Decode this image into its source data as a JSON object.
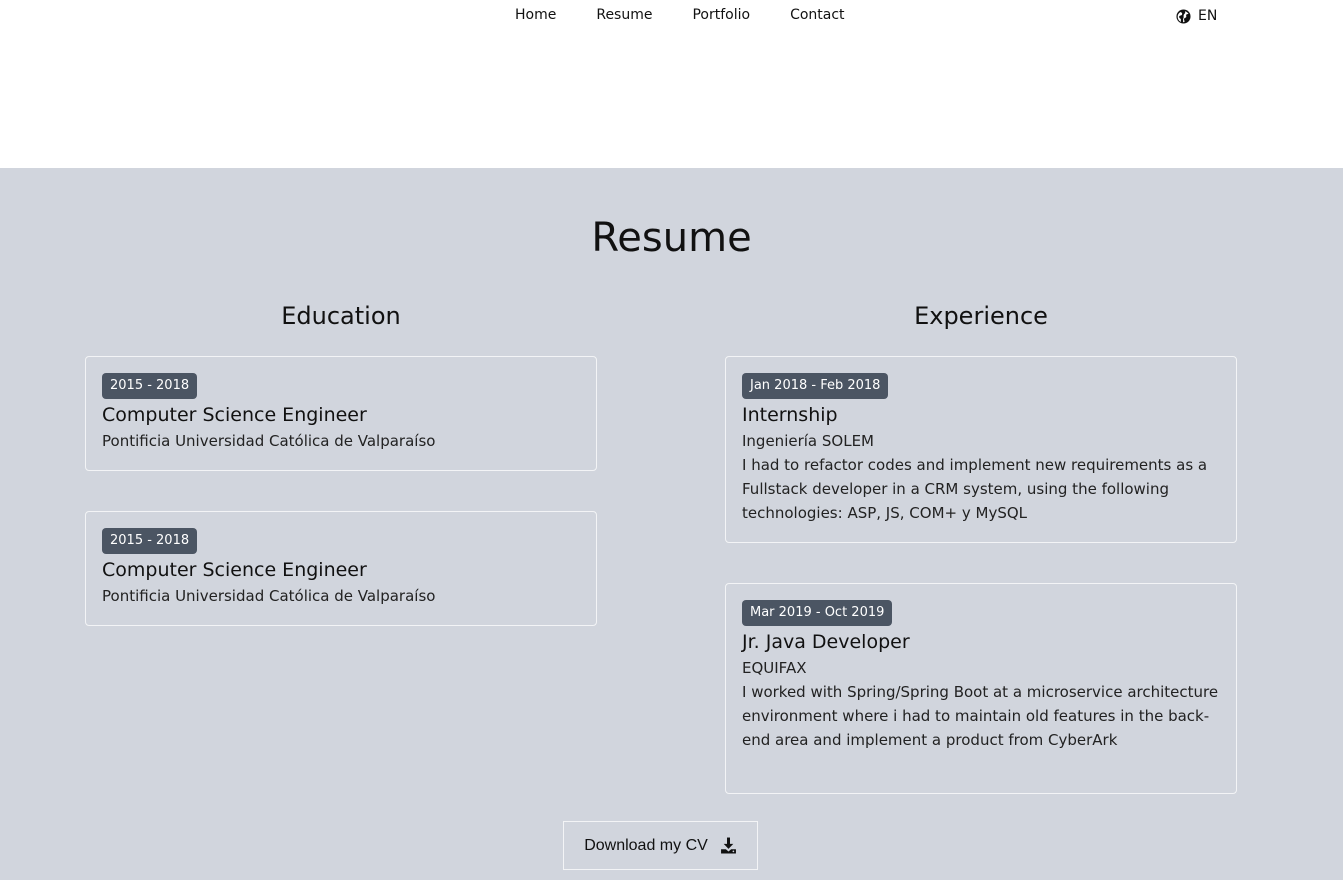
{
  "nav": {
    "items": [
      "Home",
      "Resume",
      "Portfolio",
      "Contact"
    ],
    "language": "EN"
  },
  "resume": {
    "title": "Resume",
    "education": {
      "title": "Education",
      "items": [
        {
          "dates": "2015 - 2018",
          "title": "Computer Science Engineer",
          "org": "Pontificia Universidad Católica de Valparaíso"
        },
        {
          "dates": "2015 - 2018",
          "title": "Computer Science Engineer",
          "org": "Pontificia Universidad Católica de Valparaíso"
        }
      ]
    },
    "experience": {
      "title": "Experience",
      "items": [
        {
          "dates": "Jan 2018 - Feb 2018",
          "title": "Internship",
          "org": "Ingeniería SOLEM",
          "description": "I had to refactor codes and implement new requirements as a Fullstack developer in a CRM system, using the following technologies: ASP, JS, COM+ y MySQL"
        },
        {
          "dates": "Mar 2019 - Oct 2019",
          "title": "Jr. Java Developer",
          "org": "EQUIFAX",
          "description": "I worked with Spring/Spring Boot at a microservice architecture environment where i had to maintain old features in the back-end area and implement a product from CyberArk"
        }
      ]
    },
    "download_label": "Download my CV"
  },
  "icons": {
    "language": "globe-icon",
    "download": "download-icon"
  },
  "colors": {
    "section_bg": "#d1d5dd",
    "badge_bg": "#4b5563",
    "card_border": "#f3f4f6"
  }
}
